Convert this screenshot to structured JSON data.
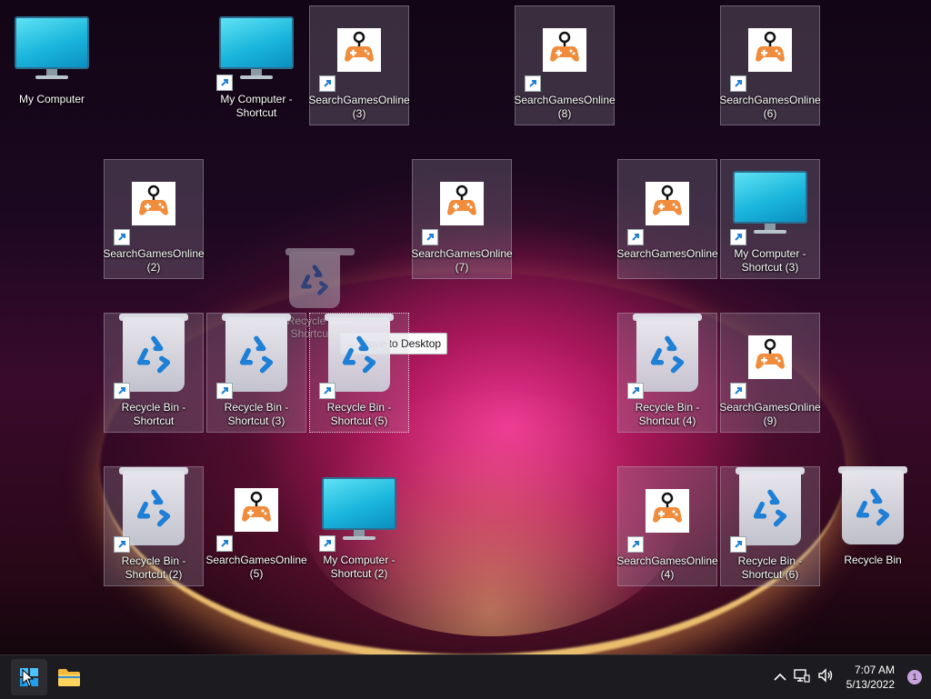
{
  "desktop": {
    "icons": [
      {
        "label": "My Computer"
      },
      {
        "label": "My Computer - Shortcut"
      },
      {
        "label": "SearchGamesOnline (3)"
      },
      {
        "label": "SearchGamesOnline (8)"
      },
      {
        "label": "SearchGamesOnline (6)"
      },
      {
        "label": "SearchGamesOnline (2)"
      },
      {
        "label": "SearchGamesOnline (7)"
      },
      {
        "label": "SearchGamesOnline"
      },
      {
        "label": "My Computer - Shortcut (3)"
      },
      {
        "label": "Recycle Bin - Shortcut"
      },
      {
        "label": "Recycle Bin - Shortcut (3)"
      },
      {
        "label": "Recycle Bin - Shortcut (5)"
      },
      {
        "label": "Recycle Bin - Shortcut (4)"
      },
      {
        "label": "SearchGamesOnline (9)"
      },
      {
        "label": "Recycle Bin - Shortcut (2)"
      },
      {
        "label": "SearchGamesOnline (5)"
      },
      {
        "label": "My Computer - Shortcut (2)"
      },
      {
        "label": "SearchGamesOnline (4)"
      },
      {
        "label": "Recycle Bin - Shortcut (6)"
      },
      {
        "label": "Recycle Bin"
      }
    ],
    "drag_ghost_label": "Recycle Bin - Shortcut (5)",
    "drag_tooltip": "Move to Desktop"
  },
  "taskbar": {
    "clock_time": "7:07 AM",
    "clock_date": "5/13/2022",
    "notification_count": "1"
  },
  "colors": {
    "taskbar_bg": "#1c1c20",
    "game_orange": "#f08c3c",
    "recycle_blue": "#1d7fd6"
  }
}
